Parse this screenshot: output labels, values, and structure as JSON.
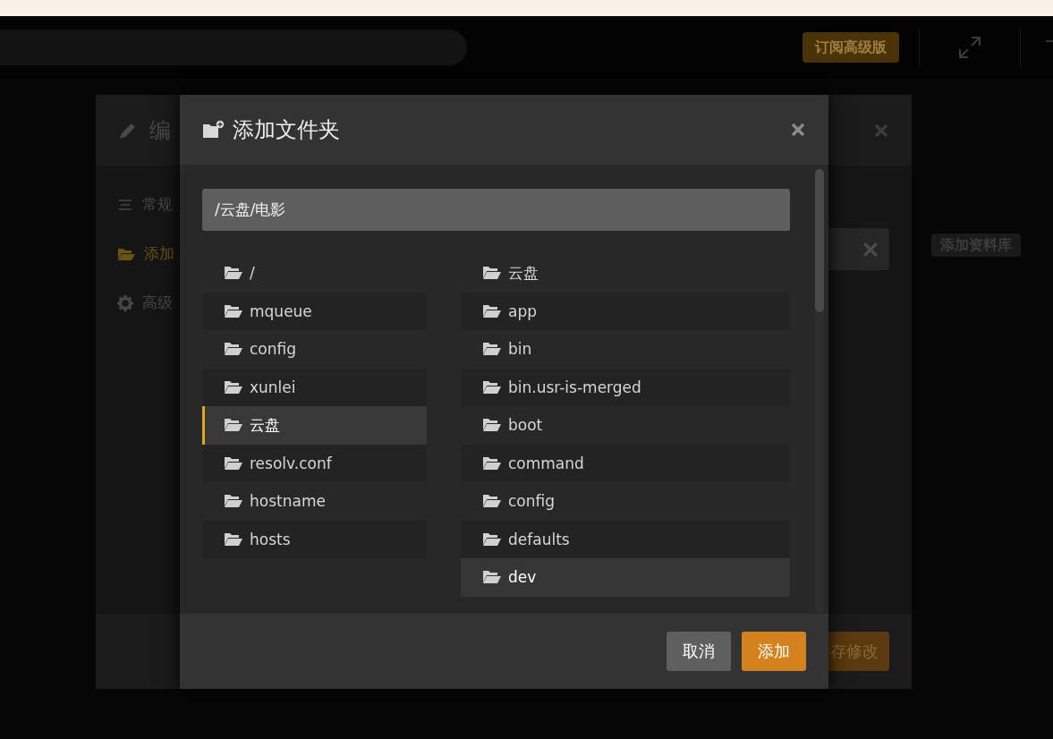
{
  "top_bar": {
    "upgrade_button": "订阅高级版"
  },
  "edit_dialog": {
    "title": "编",
    "menu": [
      {
        "kind": "list",
        "label": "常规",
        "selected": false
      },
      {
        "kind": "folder",
        "label": "添加",
        "selected": true
      },
      {
        "kind": "gear",
        "label": "高级",
        "selected": false
      }
    ],
    "save_button": "存修改"
  },
  "add_library_button": "添加资料库",
  "modal": {
    "title": "添加文件夹",
    "path": "/云盘/电影",
    "left_list": [
      {
        "label": "/",
        "selected": false
      },
      {
        "label": "mqueue",
        "selected": false
      },
      {
        "label": "config",
        "selected": false
      },
      {
        "label": "xunlei",
        "selected": false
      },
      {
        "label": "云盘",
        "selected": true
      },
      {
        "label": "resolv.conf",
        "selected": false
      },
      {
        "label": "hostname",
        "selected": false
      },
      {
        "label": "hosts",
        "selected": false
      }
    ],
    "right_list": [
      {
        "label": "云盘",
        "selected": false,
        "highlighted": false
      },
      {
        "label": "app",
        "selected": false,
        "highlighted": false
      },
      {
        "label": "bin",
        "selected": false,
        "highlighted": false
      },
      {
        "label": "bin.usr-is-merged",
        "selected": false,
        "highlighted": false
      },
      {
        "label": "boot",
        "selected": false,
        "highlighted": false
      },
      {
        "label": "command",
        "selected": false,
        "highlighted": false
      },
      {
        "label": "config",
        "selected": false,
        "highlighted": false
      },
      {
        "label": "defaults",
        "selected": false,
        "highlighted": false
      },
      {
        "label": "dev",
        "selected": false,
        "highlighted": true
      }
    ],
    "buttons": [
      {
        "kind": "secondary",
        "label": "取消"
      },
      {
        "kind": "primary",
        "label": "添加"
      }
    ]
  }
}
